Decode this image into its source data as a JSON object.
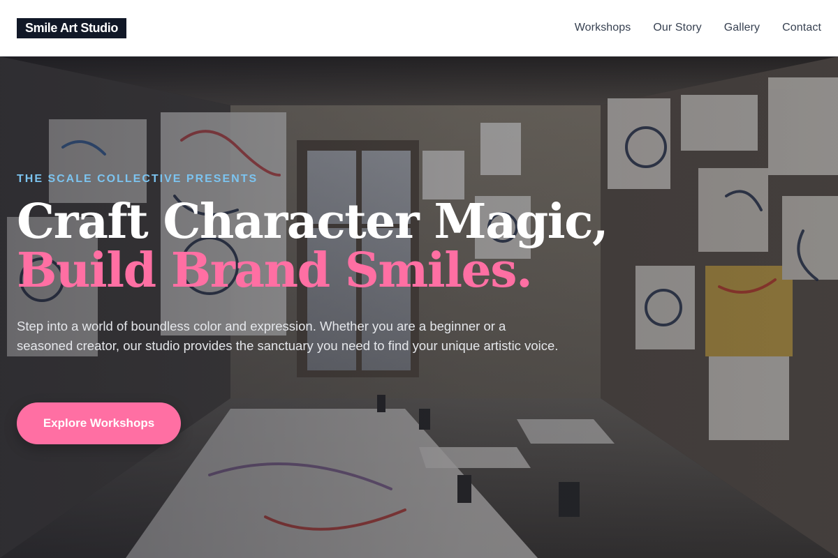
{
  "header": {
    "logo": "Smile Art Studio",
    "nav": [
      {
        "label": "Workshops"
      },
      {
        "label": "Our Story"
      },
      {
        "label": "Gallery"
      },
      {
        "label": "Contact"
      }
    ]
  },
  "hero": {
    "eyebrow": "THE SCALE COLLECTIVE PRESENTS",
    "headline_line1": "Craft Character Magic,",
    "headline_line2": "Build Brand Smiles.",
    "description": "Step into a world of boundless color and expression. Whether you are a beginner or a seasoned creator, our studio provides the sanctuary you need to find your unique artistic voice.",
    "cta_label": "Explore Workshops",
    "background_image": "art-studio-room-photo"
  },
  "colors": {
    "accent_pink": "#ff6fa3",
    "eyebrow_blue": "#7cc4f0",
    "logo_bg": "#111827",
    "nav_text": "#374151"
  }
}
